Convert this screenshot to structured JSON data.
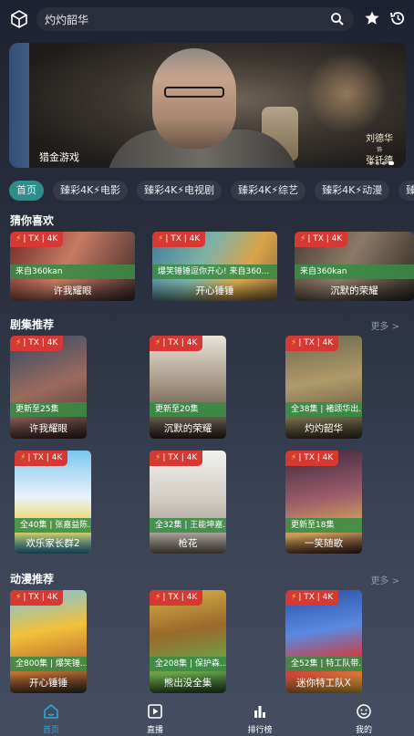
{
  "header": {
    "search_text": "灼灼韶华"
  },
  "banner": {
    "title": "猎金游戏",
    "cast_top": "刘德华",
    "cast_mid": "饰",
    "cast_bottom": "张托德"
  },
  "tabs": [
    "首页",
    "臻彩4K⚡电影",
    "臻彩4K⚡电视剧",
    "臻彩4K⚡综艺",
    "臻彩4K⚡动漫",
    "臻"
  ],
  "badge": {
    "bolt": "⚡",
    "text": "| TX | 4K"
  },
  "sections": {
    "guess": {
      "title": "猜你喜欢"
    },
    "drama": {
      "title": "剧集推荐",
      "more": "更多 >"
    },
    "anime": {
      "title": "动漫推荐",
      "more": "更多 >"
    }
  },
  "guess_items": [
    {
      "info": "来自360kan",
      "title": "许我耀眼"
    },
    {
      "info": "爆笑锤锤逗你开心!  来自360...",
      "title": "开心锤锤"
    },
    {
      "info": "来自360kan",
      "title": "沉默的荣耀"
    }
  ],
  "drama_items": [
    {
      "info": "更新至25集",
      "title": "许我耀眼"
    },
    {
      "info": "更新至20集",
      "title": "沉默的荣耀"
    },
    {
      "info": "全38集 | 褚颂华出...",
      "title": "灼灼韶华"
    },
    {
      "info": "全40集 | 张嘉益陈...",
      "title": "欢乐家长群2"
    },
    {
      "info": "全32集 | 王能坤嘉...",
      "title": "枪花"
    },
    {
      "info": "更新至18集",
      "title": "一笑随歌"
    }
  ],
  "anime_items": [
    {
      "info": "全800集 | 爆笑锤...",
      "title": "开心锤锤"
    },
    {
      "info": "全208集 | 保护森...",
      "title": "熊出没全集"
    },
    {
      "info": "全52集 | 特工队带...",
      "title": "迷你特工队X"
    }
  ],
  "nav": {
    "home": "首页",
    "live": "直播",
    "rank": "排行榜",
    "mine": "我的"
  },
  "colors": {
    "accent": "#2aa8d8",
    "tab_active": "#2c8e89",
    "badge": "#d43a33",
    "info_bar": "#388c46"
  }
}
